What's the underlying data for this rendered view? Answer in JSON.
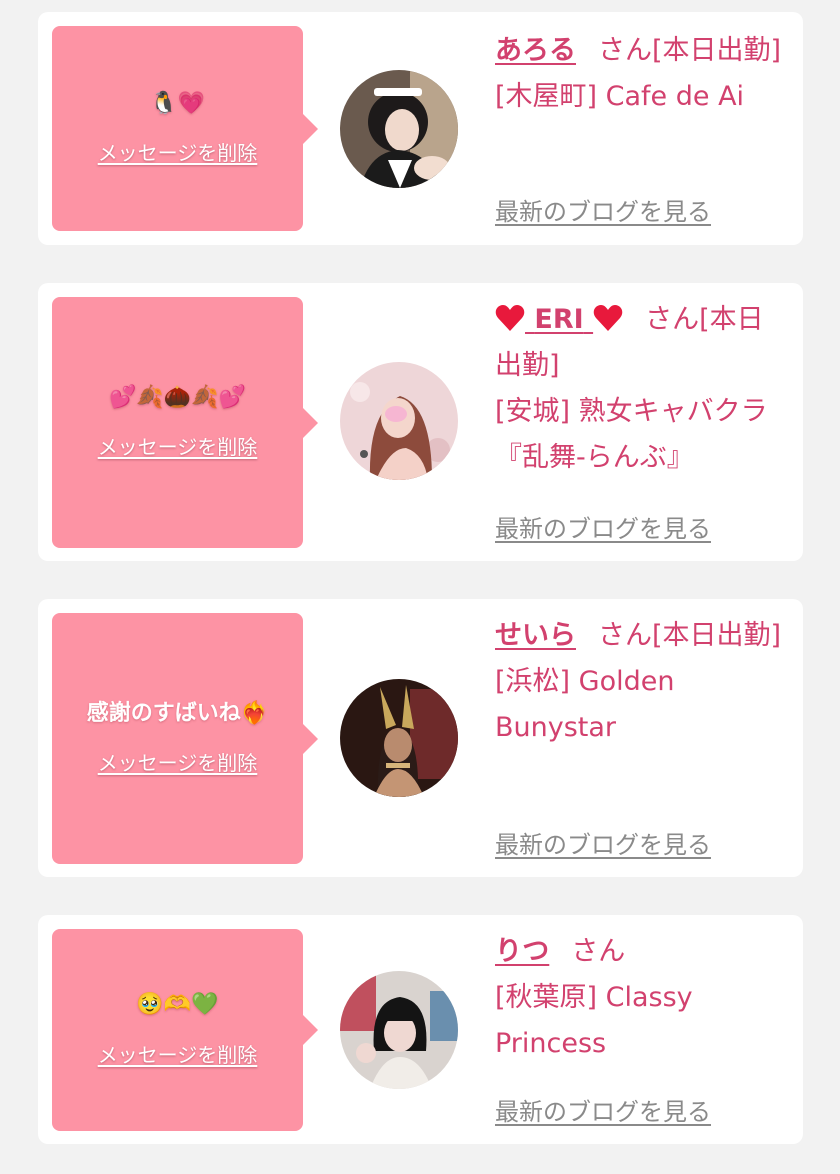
{
  "delete_label": "メッセージを削除",
  "blog_label": "最新のブログを見る",
  "colors": {
    "page_bg": "#f2f2f2",
    "bubble": "#fd93a4",
    "accent": "#d2416e",
    "muted": "#8a8a8a"
  },
  "cards": [
    {
      "message": "🐧💗",
      "name": "あろる",
      "suffix": "さん[本日出勤]",
      "shop": "[木屋町] Cafe de Ai"
    },
    {
      "message": "💕🍂🌰🍂💕",
      "name": "ERI",
      "name_icons": "heart-icon",
      "suffix": "さん[本日出勤]",
      "shop": "[安城] 熟女キャバクラ『乱舞-らんぶ』"
    },
    {
      "message": "感謝のすばいね❤️‍🔥",
      "name": "せいら",
      "suffix": "さん[本日出勤]",
      "shop": "[浜松] Golden Bunystar"
    },
    {
      "message": "🥹🫶💚",
      "name": "りつ",
      "suffix": "さん",
      "shop": "[秋葉原] Classy Princess"
    }
  ]
}
